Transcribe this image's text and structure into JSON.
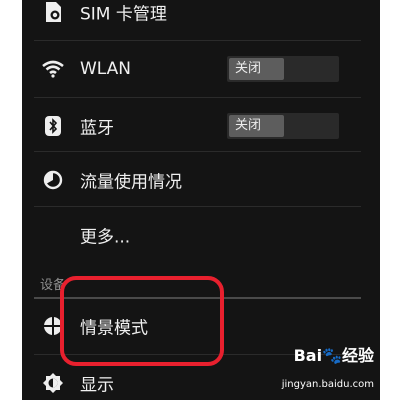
{
  "settings": {
    "items": [
      {
        "label": "SIM 卡管理",
        "icon": "sim-card-icon"
      },
      {
        "label": "WLAN",
        "icon": "wifi-icon",
        "toggle": "关闭"
      },
      {
        "label": "蓝牙",
        "icon": "bluetooth-icon",
        "toggle": "关闭"
      },
      {
        "label": "流量使用情况",
        "icon": "data-usage-icon"
      },
      {
        "label": "更多..."
      }
    ],
    "section_device": "设备",
    "device_items": [
      {
        "label": "情景模式",
        "icon": "audio-profiles-icon"
      },
      {
        "label": "显示",
        "icon": "display-icon"
      }
    ]
  },
  "watermark": {
    "brand": "Bai🐾经验",
    "url": "jingyan.baidu.com"
  },
  "colors": {
    "background": "#141414",
    "text": "#f0f0f0",
    "toggle_track": "#2a2a2a",
    "toggle_knob": "#5d5d5d",
    "highlight": "#e8202e",
    "section_header": "#8e8e8e"
  }
}
